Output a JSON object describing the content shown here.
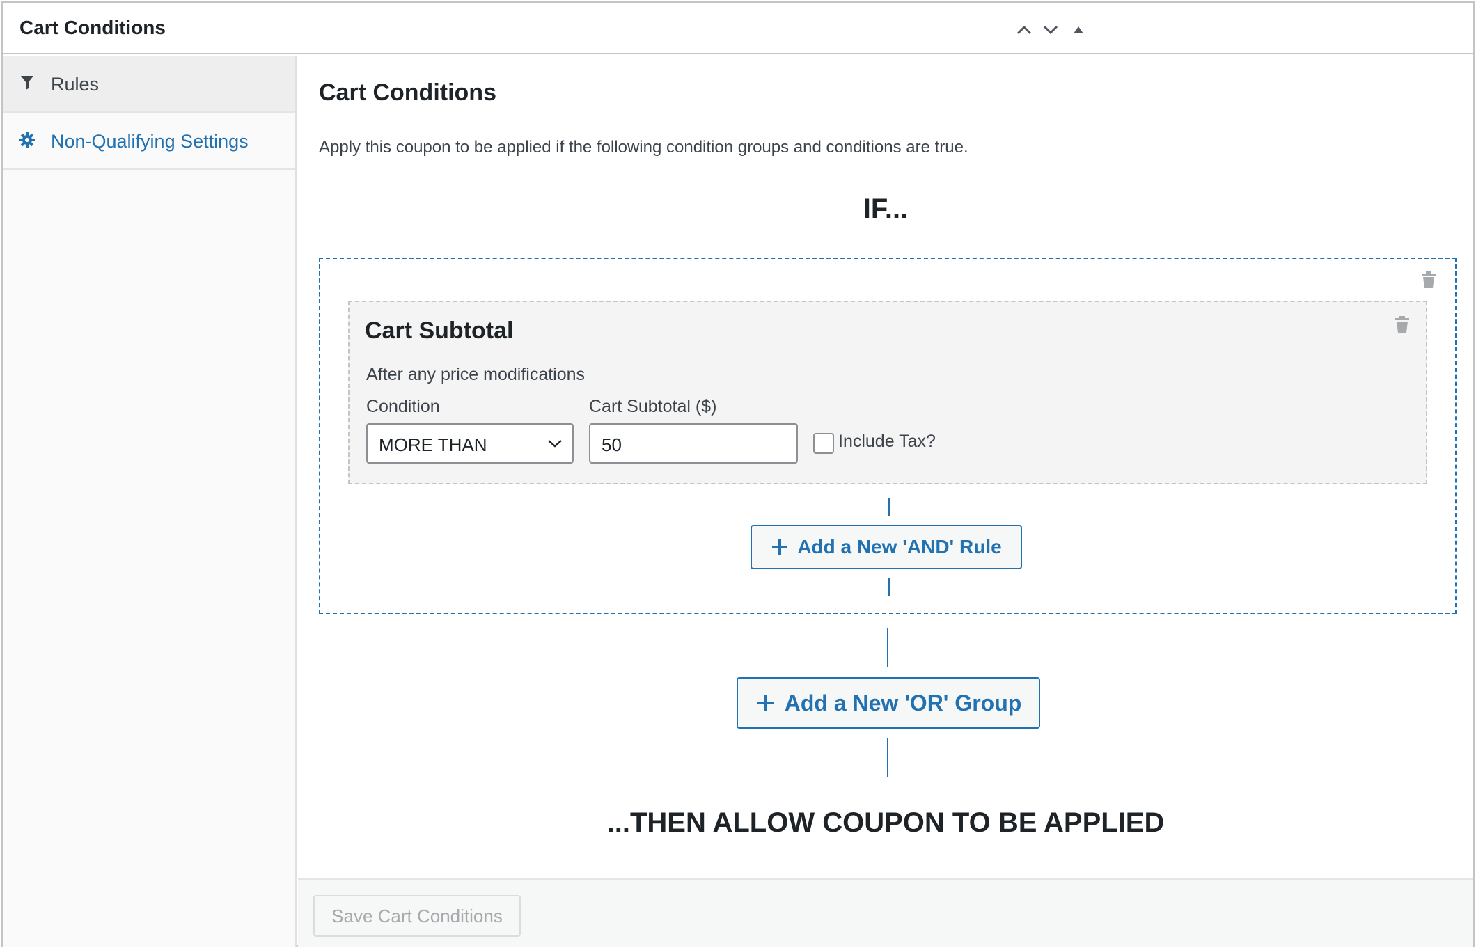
{
  "panel": {
    "title": "Cart Conditions"
  },
  "sidebar": {
    "items": [
      {
        "label": "Rules",
        "icon": "filter-icon",
        "active": true
      },
      {
        "label": "Non-Qualifying Settings",
        "icon": "gear-icon",
        "active": false
      }
    ]
  },
  "main": {
    "title": "Cart Conditions",
    "description": "Apply this coupon to be applied if the following condition groups and conditions are true.",
    "if_label": "IF...",
    "then_label": "...THEN ALLOW COUPON TO BE APPLIED"
  },
  "condition": {
    "title": "Cart Subtotal",
    "subtitle": "After any price modifications",
    "condition_label": "Condition",
    "condition_value": "MORE THAN",
    "subtotal_label": "Cart Subtotal ($)",
    "subtotal_value": "50",
    "include_tax_label": "Include Tax?",
    "include_tax_checked": false
  },
  "buttons": {
    "add_and_rule": "Add a New 'AND' Rule",
    "add_or_group": "Add a New 'OR' Group",
    "save": "Save Cart Conditions"
  },
  "colors": {
    "accent": "#2271b1",
    "border": "#c3c4c7",
    "disabled_text": "#a7aaad"
  }
}
